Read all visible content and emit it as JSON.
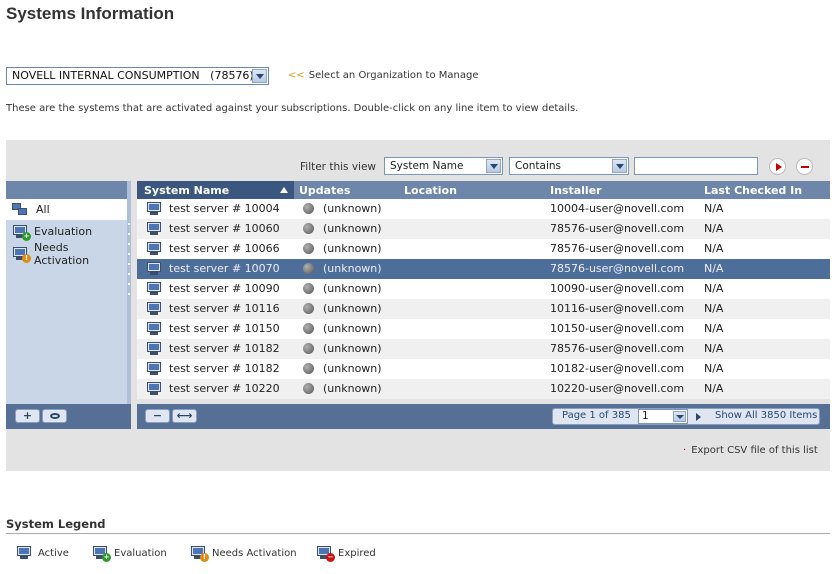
{
  "page_title": "Systems Information",
  "org_selector": {
    "value": "NOVELL INTERNAL CONSUMPTION   (78576)",
    "hint_chevrons": "<<",
    "hint": "Select an Organization to Manage"
  },
  "intro_text": "These are the systems that are activated against your subscriptions. Double-click on any line item to view details.",
  "filter": {
    "label": "Filter this view",
    "field": "System Name",
    "operator": "Contains",
    "value": ""
  },
  "left_panel": {
    "items": [
      {
        "label": "All",
        "icon": "all-systems-icon",
        "selected": true
      },
      {
        "label": "Evaluation",
        "icon": "evaluation-icon",
        "selected": false
      },
      {
        "label": "Needs Activation",
        "icon": "needs-activation-icon",
        "selected": false
      }
    ],
    "footer_add": "+",
    "footer_view": "view-icon"
  },
  "grid": {
    "columns": [
      "System Name",
      "Updates",
      "Location",
      "Installer",
      "Last Checked In"
    ],
    "sorted_column": "System Name",
    "rows": [
      {
        "name": "test server # 10004",
        "updates": "(unknown)",
        "location": "",
        "installer": "10004-user@novell.com",
        "last": "N/A"
      },
      {
        "name": "test server # 10060",
        "updates": "(unknown)",
        "location": "",
        "installer": "78576-user@novell.com",
        "last": "N/A"
      },
      {
        "name": "test server # 10066",
        "updates": "(unknown)",
        "location": "",
        "installer": "78576-user@novell.com",
        "last": "N/A"
      },
      {
        "name": "test server # 10070",
        "updates": "(unknown)",
        "location": "",
        "installer": "78576-user@novell.com",
        "last": "N/A"
      },
      {
        "name": "test server # 10090",
        "updates": "(unknown)",
        "location": "",
        "installer": "10090-user@novell.com",
        "last": "N/A"
      },
      {
        "name": "test server # 10116",
        "updates": "(unknown)",
        "location": "",
        "installer": "10116-user@novell.com",
        "last": "N/A"
      },
      {
        "name": "test server # 10150",
        "updates": "(unknown)",
        "location": "",
        "installer": "10150-user@novell.com",
        "last": "N/A"
      },
      {
        "name": "test server # 10182",
        "updates": "(unknown)",
        "location": "",
        "installer": "78576-user@novell.com",
        "last": "N/A"
      },
      {
        "name": "test server # 10182",
        "updates": "(unknown)",
        "location": "",
        "installer": "10182-user@novell.com",
        "last": "N/A"
      },
      {
        "name": "test server # 10220",
        "updates": "(unknown)",
        "location": "",
        "installer": "10220-user@novell.com",
        "last": "N/A"
      }
    ],
    "selected_row": 3
  },
  "pager": {
    "label": "Page 1 of 385",
    "page_value": "1",
    "show_all": "Show All 3850 Items"
  },
  "grid_footer": {
    "remove": "−",
    "resize": "⟷"
  },
  "export_link": "Export CSV file of this list",
  "legend": {
    "title": "System Legend",
    "items": [
      {
        "label": "Active",
        "badge": ""
      },
      {
        "label": "Evaluation",
        "badge": "green"
      },
      {
        "label": "Needs Activation",
        "badge": "orange"
      },
      {
        "label": "Expired",
        "badge": "red"
      }
    ]
  },
  "colors": {
    "header_blue": "#6d86aa",
    "selected_row": "#4d6e98",
    "footer_blue": "#556f95",
    "accent_red": "#c80000",
    "hint_orange": "#e39b1b"
  }
}
